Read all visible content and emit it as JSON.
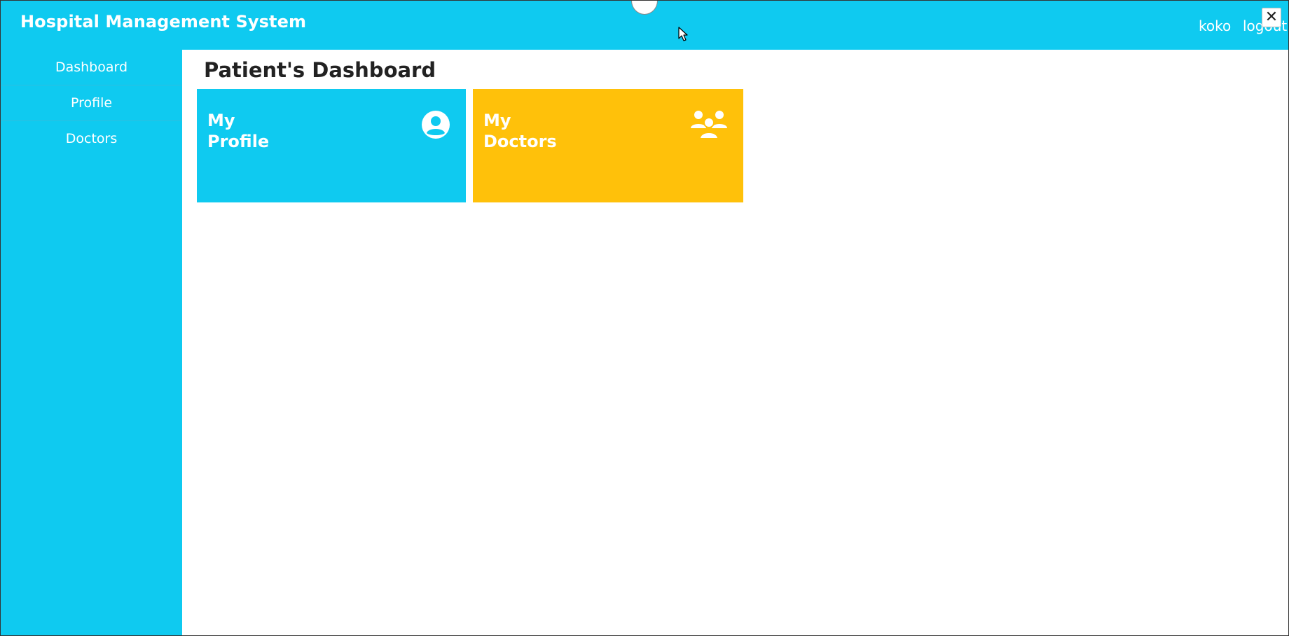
{
  "header": {
    "brand": "Hospital Management System",
    "user_name": "koko",
    "logout_label": "logout",
    "close_symbol": "✕"
  },
  "sidebar": {
    "items": [
      {
        "label": "Dashboard"
      },
      {
        "label": "Profile"
      },
      {
        "label": "Doctors"
      }
    ]
  },
  "main": {
    "title": "Patient's Dashboard",
    "cards": [
      {
        "line1": "My",
        "line2": "Profile",
        "icon": "user-circle-icon",
        "color": "#0fcaf0"
      },
      {
        "line1": "My",
        "line2": "Doctors",
        "icon": "users-group-icon",
        "color": "#ffc10a"
      }
    ]
  },
  "theme": {
    "accent": "#0fcaf0",
    "warning": "#ffc10a"
  }
}
